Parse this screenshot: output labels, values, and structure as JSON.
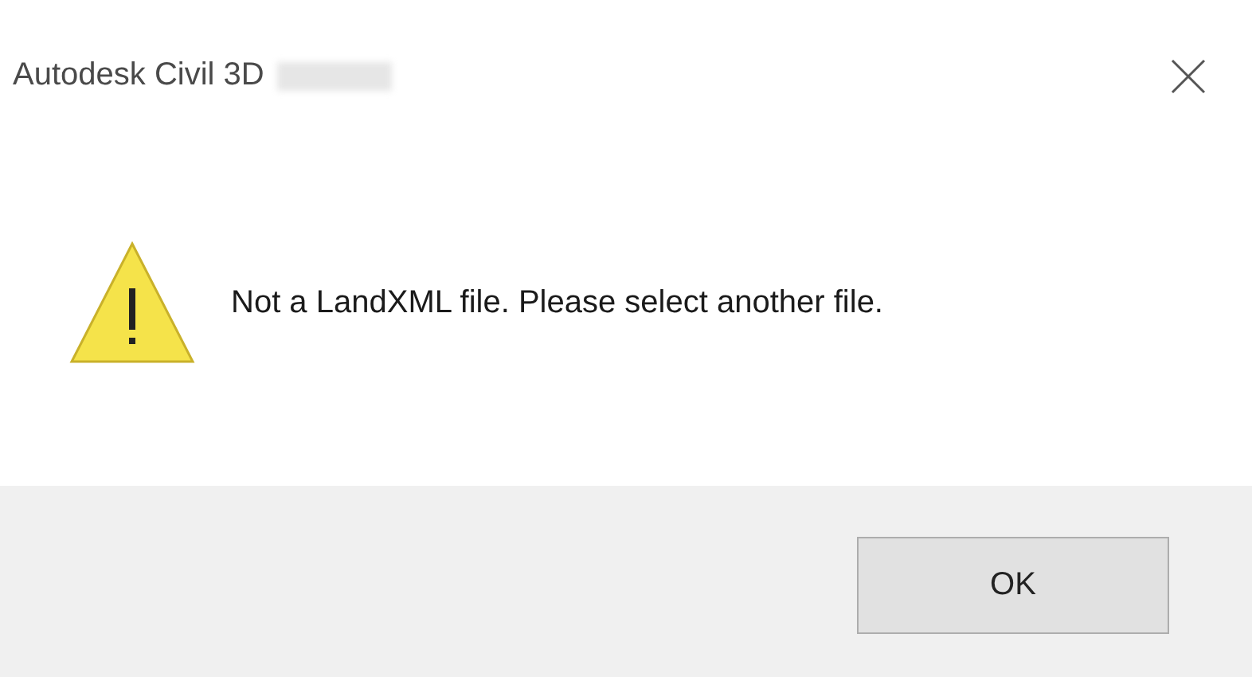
{
  "window": {
    "title": "Autodesk Civil 3D"
  },
  "message": "Not a LandXML file. Please select another file.",
  "buttons": [
    {
      "label": "OK"
    }
  ]
}
